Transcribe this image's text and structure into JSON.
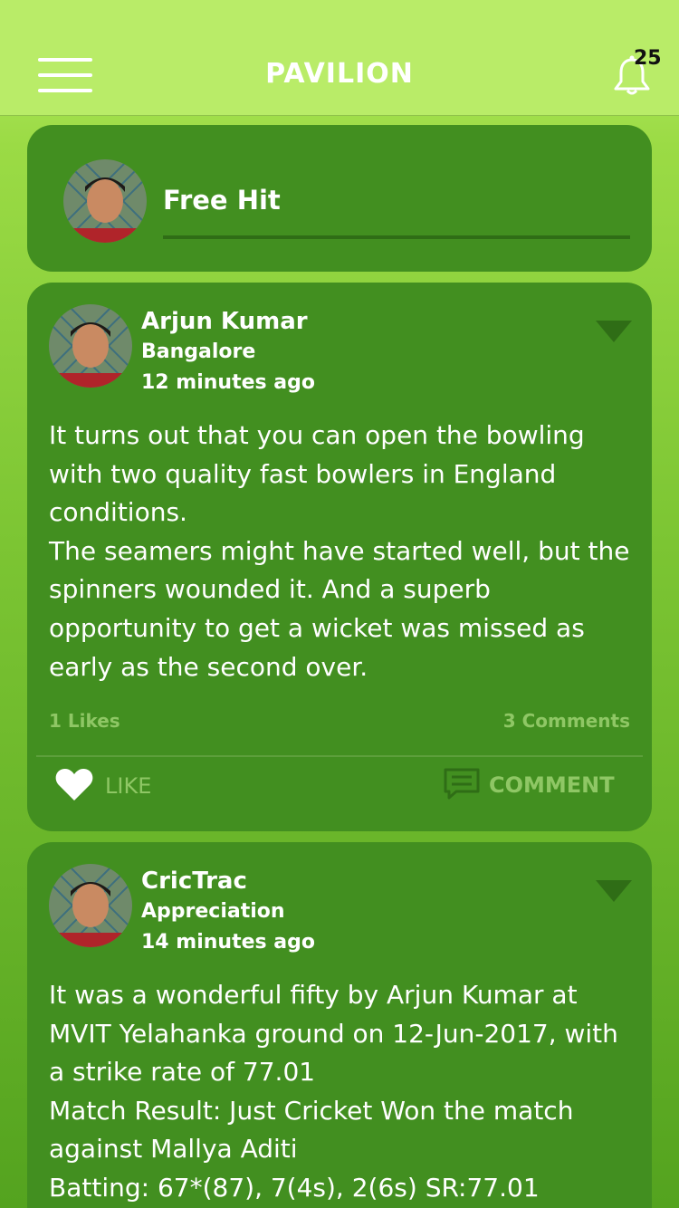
{
  "header": {
    "title": "PAVILION",
    "notification_count": "25",
    "menu_icon": "hamburger-icon",
    "bell_icon": "bell-icon"
  },
  "compose": {
    "label": "Free Hit"
  },
  "posts": [
    {
      "author": "Arjun Kumar",
      "subtitle": "Bangalore",
      "time": "12 minutes ago",
      "lines": [
        "It turns out that you can open the bowling",
        "with two quality fast bowlers in England",
        "conditions.",
        "The seamers might have started well, but the",
        "spinners wounded it. And a superb",
        "opportunity to get a wicket was missed as",
        "early as the second over."
      ],
      "likes": "1 Likes",
      "comments": "3 Comments",
      "like_label": "LIKE",
      "comment_label": "COMMENT"
    },
    {
      "author": "CricTrac",
      "subtitle": "Appreciation",
      "time": "14 minutes ago",
      "lines": [
        "It was a wonderful fifty by Arjun Kumar at",
        "MVIT Yelahanka ground on 12-Jun-2017, with",
        "a strike rate of 77.01",
        "Match Result: Just Cricket Won the match",
        "against Mallya Aditi",
        "Batting: 67*(87), 7(4s), 2(6s)  SR:77.01"
      ]
    }
  ],
  "colors": {
    "header_bg": "#b9ec68",
    "card_bg": "#428f20",
    "muted_text": "#8fc765"
  }
}
